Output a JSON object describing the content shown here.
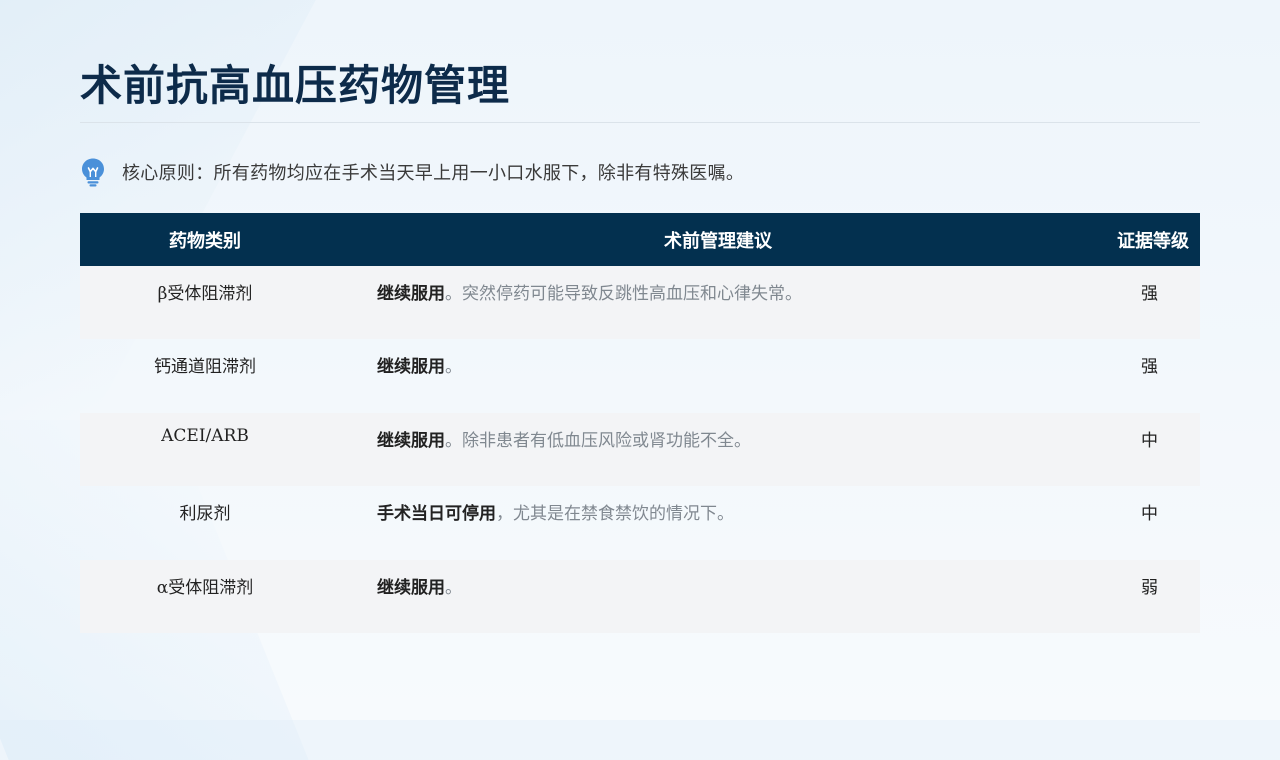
{
  "title": "术前抗高血压药物管理",
  "principle": {
    "icon": "lightbulb-icon",
    "text": "核心原则：所有药物均应在手术当天早上用一小口水服下，除非有特殊医嘱。"
  },
  "table": {
    "headers": [
      "药物类别",
      "术前管理建议",
      "证据等级"
    ],
    "rows": [
      {
        "class": "β受体阻滞剂",
        "advice_key": "继续服用",
        "advice_note": "。突然停药可能导致反跳性高血压和心律失常。",
        "level": "强"
      },
      {
        "class": "钙通道阻滞剂",
        "advice_key": "继续服用",
        "advice_note": "。",
        "level": "强"
      },
      {
        "class": "ACEI/ARB",
        "advice_key": "继续服用",
        "advice_note": "。除非患者有低血压风险或肾功能不全。",
        "level": "中"
      },
      {
        "class": "利尿剂",
        "advice_key": "手术当日可停用",
        "advice_note": "，尤其是在禁食禁饮的情况下。",
        "level": "中"
      },
      {
        "class": "α受体阻滞剂",
        "advice_key": "继续服用",
        "advice_note": "。",
        "level": "弱"
      }
    ]
  },
  "colors": {
    "title": "#0d2b4a",
    "header_bg": "#03304f",
    "header_text": "#ffffff",
    "row_alt": "#f3f4f6",
    "icon": "#4a90d9"
  }
}
